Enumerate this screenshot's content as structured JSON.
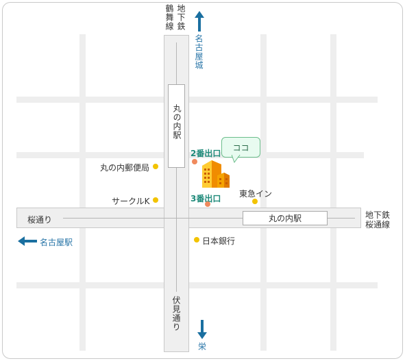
{
  "lines": {
    "tsurumai": "鶴舞線",
    "chikatetsu_top": "地下鉄",
    "chikatetsu_right": "地下鉄",
    "sakuradori_line": "桜通線"
  },
  "streets": {
    "sakura_dori": "桜通り",
    "fushimi_dori": "伏見通り"
  },
  "stations": {
    "marunouchi_vertical": "丸の内駅",
    "marunouchi_horizontal": "丸の内駅"
  },
  "exits": {
    "exit2": "2番出口",
    "exit3": "3番出口"
  },
  "directions": {
    "nagoya_castle": "名古屋城",
    "nagoya_station": "名古屋駅",
    "sakae": "栄"
  },
  "landmarks": {
    "post_office": "丸の内郵便局",
    "circle_k": "サークルK",
    "toyoko_inn": "東急イン",
    "boj": "日本銀行"
  },
  "here_label": "ココ",
  "colors": {
    "arrow_blue": "#1a6fa0",
    "landmark_yellow": "#f2c300",
    "exit_orange": "#f08a5d",
    "building_orange": "#f5a300"
  }
}
